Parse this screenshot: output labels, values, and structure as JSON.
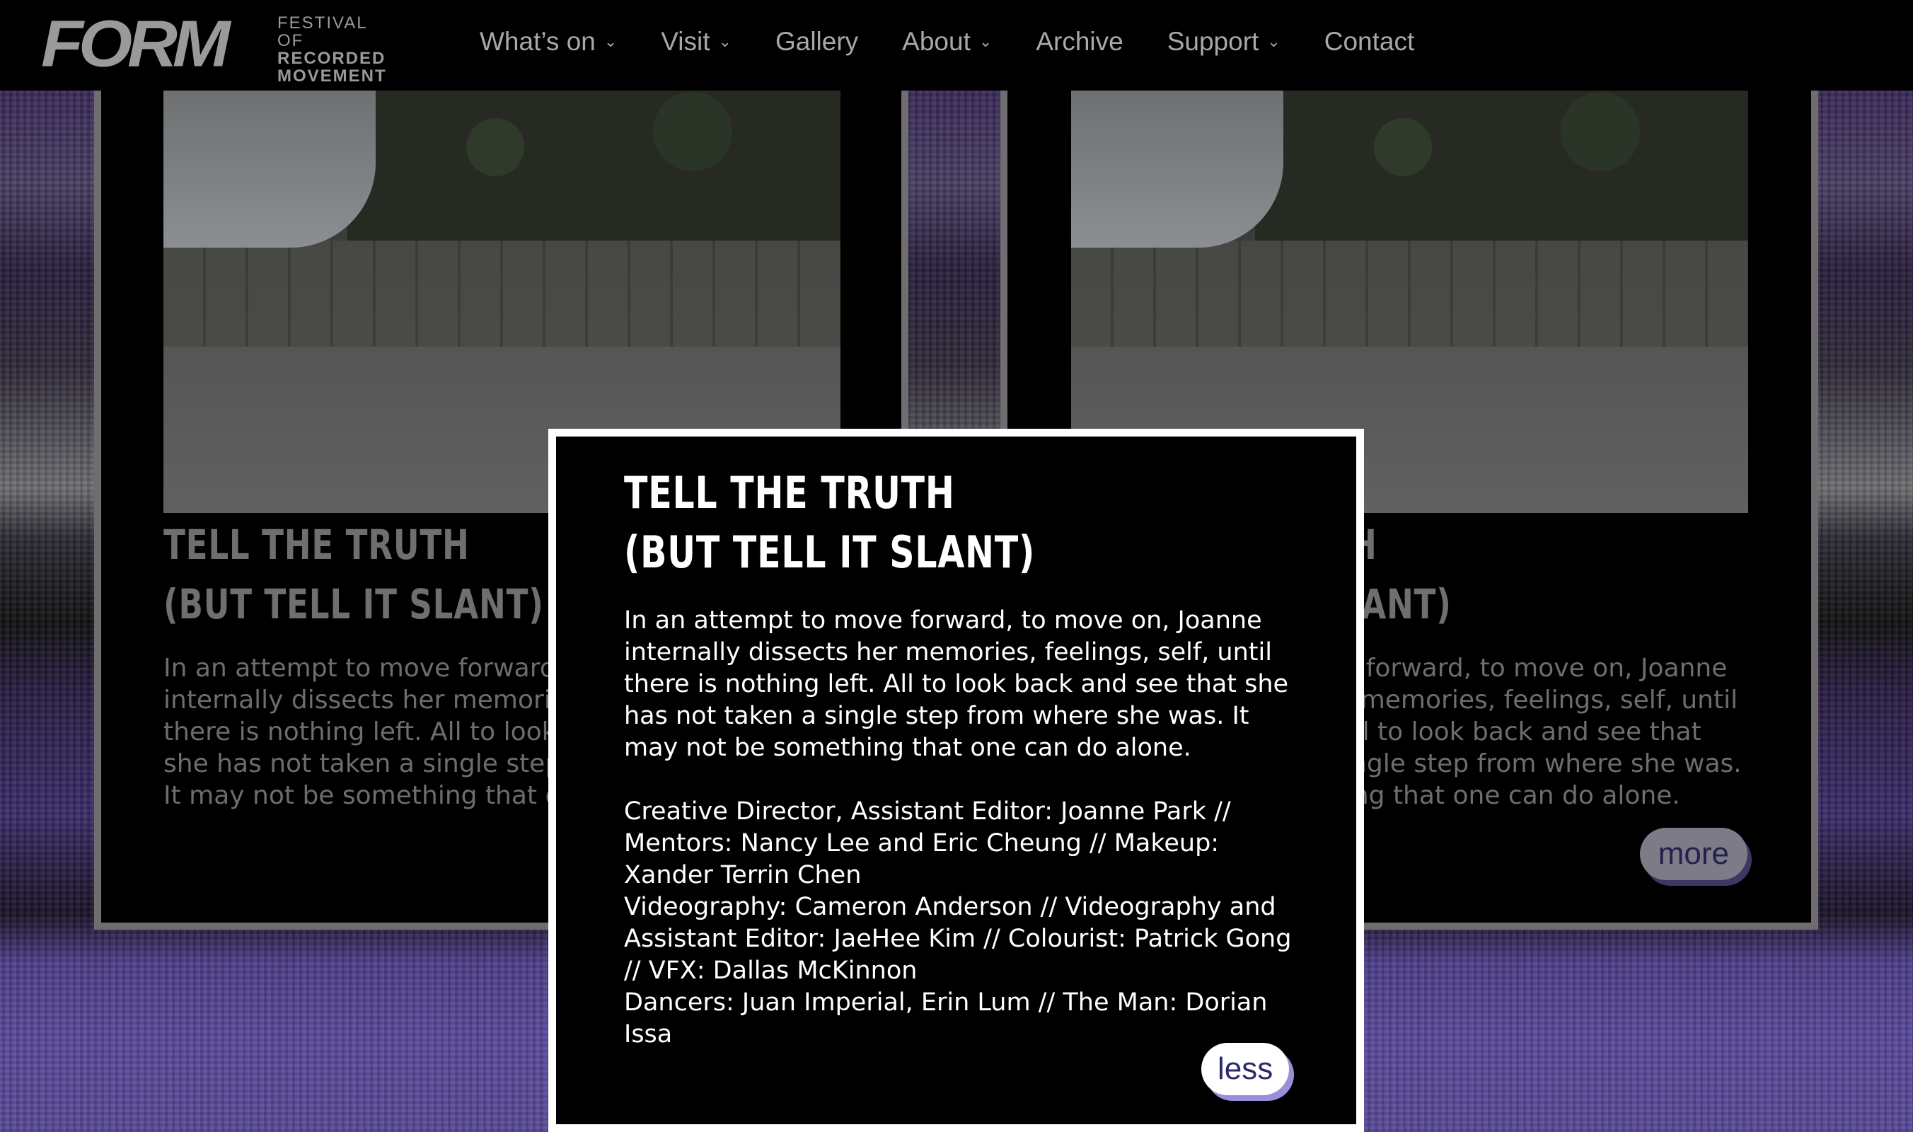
{
  "header": {
    "logo": {
      "main": "FORM",
      "sub1": "FESTIVAL OF",
      "sub2": "RECORDED",
      "sub3": "MOVEMENT"
    },
    "nav": [
      {
        "label": "What’s on",
        "has_dropdown": true
      },
      {
        "label": "Visit",
        "has_dropdown": true
      },
      {
        "label": "Gallery",
        "has_dropdown": false
      },
      {
        "label": "About",
        "has_dropdown": true
      },
      {
        "label": "Archive",
        "has_dropdown": false
      },
      {
        "label": "Support",
        "has_dropdown": true
      },
      {
        "label": "Contact",
        "has_dropdown": false
      }
    ]
  },
  "cards": [
    {
      "title_line1": "TELL THE TRUTH",
      "title_line2": "(BUT TELL IT SLANT)",
      "description": "In an attempt to move forward, to move on, Joanne internally dissects her memories, feelings, self, until there is nothing left. All to look back and see that she has not taken a single step from where she was. It may not be something that one can do alone."
    },
    {
      "title_line1": "TELL THE TRUTH",
      "title_line2": "(BUT TELL IT SLANT)",
      "description": "In an attempt to move forward, to move on, Joanne internally dissects her memories, feelings, self, until there is nothing left. All to look back and see that she has not taken a single step from where she was. It may not be something that one can do alone.",
      "more_label": "more"
    }
  ],
  "modal": {
    "title_line1": "TELL THE TRUTH",
    "title_line2": "(BUT TELL IT SLANT)",
    "description": "In an attempt to move forward, to move on, Joanne internally dissects her memories, feelings, self, until there is nothing left. All to look back and see that she has not taken a single step from where she was. It may not be something that one can do alone.",
    "credits": [
      "Creative Director, Assistant Editor: Joanne Park // Mentors: Nancy Lee and Eric Cheung // Makeup: Xander Terrin Chen",
      "Videography: Cameron Anderson // Videography and Assistant Editor: JaeHee Kim // Colourist: Patrick Gong // VFX: Dallas McKinnon",
      "Dancers: Juan Imperial, Erin Lum // The Man: Dorian Issa"
    ],
    "less_label": "less"
  },
  "colors": {
    "accent_purple": "#5b4a9c",
    "button_shadow": "#9a8fd8",
    "button_text": "#2c2a68"
  }
}
